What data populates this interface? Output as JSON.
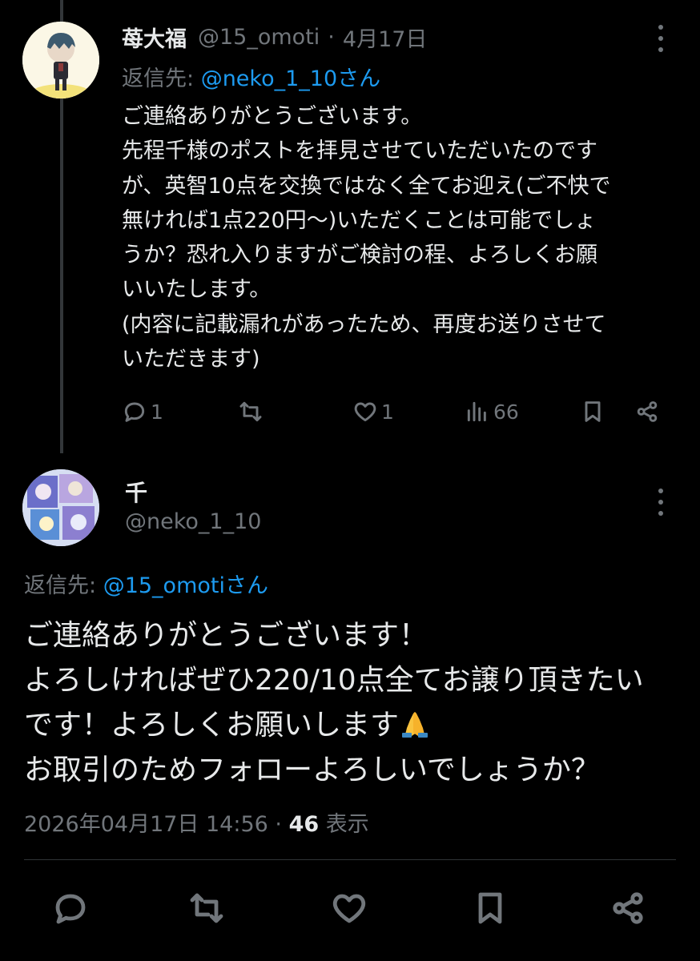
{
  "parent_tweet": {
    "display_name": "苺大福",
    "handle": "@15_omoti",
    "separator": "·",
    "date": "4月17日",
    "reply_prefix": "返信先: ",
    "reply_target": "@neko_1_10さん",
    "body_lines": [
      "ご連絡ありがとうございます。",
      "先程千様のポストを拝見させていただいたのです",
      "が、英智10点を交換ではなく全てお迎え(ご不快で",
      "無ければ1点220円〜)いただくことは可能でしょ",
      "うか？恐れ入りますがご検討の程、よろしくお願",
      "いいたします。",
      "(内容に記載漏れがあったため、再度お送りさせて",
      "いただきます)"
    ],
    "actions": {
      "reply_count": "1",
      "repost_count": "",
      "like_count": "1",
      "view_count": "66"
    }
  },
  "focused_tweet": {
    "display_name": "千",
    "handle": "@neko_1_10",
    "reply_prefix": "返信先: ",
    "reply_target": "@15_omotiさん",
    "body_lines": [
      "ご連絡ありがとうございます！",
      "よろしければぜひ220/10点全てお譲り頂きたい",
      "です！よろしくお願いします",
      "お取引のためフォローよろしいでしょうか？"
    ],
    "emoji": "folded-hands",
    "timestamp": "2026年04月17日 14:56",
    "separator": "·",
    "view_count": "46",
    "view_label": "表示"
  },
  "colors": {
    "background": "#000000",
    "text": "#e7e9ea",
    "muted": "#71767b",
    "link": "#1d9bf0",
    "divider": "#2f3336"
  },
  "icons": [
    "more-icon",
    "reply-icon",
    "repost-icon",
    "like-icon",
    "views-icon",
    "bookmark-icon",
    "share-icon",
    "folded-hands-emoji"
  ]
}
